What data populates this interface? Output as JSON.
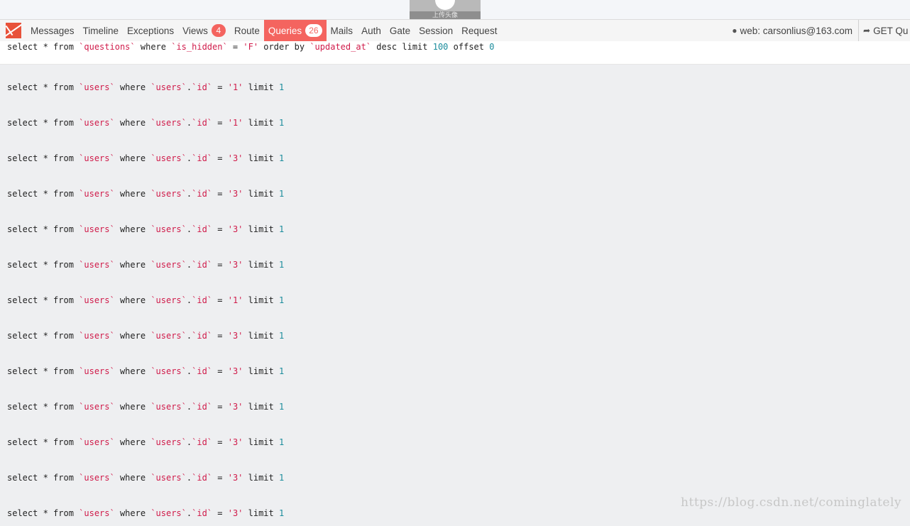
{
  "overlay": {
    "upload_label": "上传头像"
  },
  "debugbar": {
    "tabs": [
      {
        "label": "Messages",
        "badge": null
      },
      {
        "label": "Timeline",
        "badge": null
      },
      {
        "label": "Exceptions",
        "badge": null
      },
      {
        "label": "Views",
        "badge": "4"
      },
      {
        "label": "Route",
        "badge": null
      },
      {
        "label": "Queries",
        "badge": "26",
        "active": true
      },
      {
        "label": "Mails",
        "badge": null
      },
      {
        "label": "Auth",
        "badge": null
      },
      {
        "label": "Gate",
        "badge": null
      },
      {
        "label": "Session",
        "badge": null
      },
      {
        "label": "Request",
        "badge": null
      }
    ],
    "user": "web: carsonlius@163.com",
    "request": "GET Qu",
    "colors": {
      "accent": "#f4645f",
      "string": "#d01b4a",
      "number": "#1b8c9c"
    }
  },
  "queries": [
    [
      {
        "t": "select * from ",
        "c": "kw"
      },
      {
        "t": "`questions`",
        "c": "str"
      },
      {
        "t": " where ",
        "c": "kw"
      },
      {
        "t": "`is_hidden`",
        "c": "str"
      },
      {
        "t": " = ",
        "c": "kw"
      },
      {
        "t": "'F'",
        "c": "str"
      },
      {
        "t": " order by ",
        "c": "kw"
      },
      {
        "t": "`updated_at`",
        "c": "str"
      },
      {
        "t": " desc limit ",
        "c": "kw"
      },
      {
        "t": "100",
        "c": "num"
      },
      {
        "t": " offset ",
        "c": "kw"
      },
      {
        "t": "0",
        "c": "num"
      }
    ],
    [
      {
        "t": "select * from ",
        "c": "kw"
      },
      {
        "t": "`users`",
        "c": "str"
      },
      {
        "t": " where ",
        "c": "kw"
      },
      {
        "t": "`users`",
        "c": "str"
      },
      {
        "t": ".",
        "c": "kw"
      },
      {
        "t": "`id`",
        "c": "str"
      },
      {
        "t": " = ",
        "c": "kw"
      },
      {
        "t": "'1'",
        "c": "str"
      },
      {
        "t": " limit ",
        "c": "kw"
      },
      {
        "t": "1",
        "c": "num"
      }
    ],
    [
      {
        "t": "select * from ",
        "c": "kw"
      },
      {
        "t": "`users`",
        "c": "str"
      },
      {
        "t": " where ",
        "c": "kw"
      },
      {
        "t": "`users`",
        "c": "str"
      },
      {
        "t": ".",
        "c": "kw"
      },
      {
        "t": "`id`",
        "c": "str"
      },
      {
        "t": " = ",
        "c": "kw"
      },
      {
        "t": "'1'",
        "c": "str"
      },
      {
        "t": " limit ",
        "c": "kw"
      },
      {
        "t": "1",
        "c": "num"
      }
    ],
    [
      {
        "t": "select * from ",
        "c": "kw"
      },
      {
        "t": "`users`",
        "c": "str"
      },
      {
        "t": " where ",
        "c": "kw"
      },
      {
        "t": "`users`",
        "c": "str"
      },
      {
        "t": ".",
        "c": "kw"
      },
      {
        "t": "`id`",
        "c": "str"
      },
      {
        "t": " = ",
        "c": "kw"
      },
      {
        "t": "'3'",
        "c": "str"
      },
      {
        "t": " limit ",
        "c": "kw"
      },
      {
        "t": "1",
        "c": "num"
      }
    ],
    [
      {
        "t": "select * from ",
        "c": "kw"
      },
      {
        "t": "`users`",
        "c": "str"
      },
      {
        "t": " where ",
        "c": "kw"
      },
      {
        "t": "`users`",
        "c": "str"
      },
      {
        "t": ".",
        "c": "kw"
      },
      {
        "t": "`id`",
        "c": "str"
      },
      {
        "t": " = ",
        "c": "kw"
      },
      {
        "t": "'3'",
        "c": "str"
      },
      {
        "t": " limit ",
        "c": "kw"
      },
      {
        "t": "1",
        "c": "num"
      }
    ],
    [
      {
        "t": "select * from ",
        "c": "kw"
      },
      {
        "t": "`users`",
        "c": "str"
      },
      {
        "t": " where ",
        "c": "kw"
      },
      {
        "t": "`users`",
        "c": "str"
      },
      {
        "t": ".",
        "c": "kw"
      },
      {
        "t": "`id`",
        "c": "str"
      },
      {
        "t": " = ",
        "c": "kw"
      },
      {
        "t": "'3'",
        "c": "str"
      },
      {
        "t": " limit ",
        "c": "kw"
      },
      {
        "t": "1",
        "c": "num"
      }
    ],
    [
      {
        "t": "select * from ",
        "c": "kw"
      },
      {
        "t": "`users`",
        "c": "str"
      },
      {
        "t": " where ",
        "c": "kw"
      },
      {
        "t": "`users`",
        "c": "str"
      },
      {
        "t": ".",
        "c": "kw"
      },
      {
        "t": "`id`",
        "c": "str"
      },
      {
        "t": " = ",
        "c": "kw"
      },
      {
        "t": "'3'",
        "c": "str"
      },
      {
        "t": " limit ",
        "c": "kw"
      },
      {
        "t": "1",
        "c": "num"
      }
    ],
    [
      {
        "t": "select * from ",
        "c": "kw"
      },
      {
        "t": "`users`",
        "c": "str"
      },
      {
        "t": " where ",
        "c": "kw"
      },
      {
        "t": "`users`",
        "c": "str"
      },
      {
        "t": ".",
        "c": "kw"
      },
      {
        "t": "`id`",
        "c": "str"
      },
      {
        "t": " = ",
        "c": "kw"
      },
      {
        "t": "'1'",
        "c": "str"
      },
      {
        "t": " limit ",
        "c": "kw"
      },
      {
        "t": "1",
        "c": "num"
      }
    ],
    [
      {
        "t": "select * from ",
        "c": "kw"
      },
      {
        "t": "`users`",
        "c": "str"
      },
      {
        "t": " where ",
        "c": "kw"
      },
      {
        "t": "`users`",
        "c": "str"
      },
      {
        "t": ".",
        "c": "kw"
      },
      {
        "t": "`id`",
        "c": "str"
      },
      {
        "t": " = ",
        "c": "kw"
      },
      {
        "t": "'3'",
        "c": "str"
      },
      {
        "t": " limit ",
        "c": "kw"
      },
      {
        "t": "1",
        "c": "num"
      }
    ],
    [
      {
        "t": "select * from ",
        "c": "kw"
      },
      {
        "t": "`users`",
        "c": "str"
      },
      {
        "t": " where ",
        "c": "kw"
      },
      {
        "t": "`users`",
        "c": "str"
      },
      {
        "t": ".",
        "c": "kw"
      },
      {
        "t": "`id`",
        "c": "str"
      },
      {
        "t": " = ",
        "c": "kw"
      },
      {
        "t": "'3'",
        "c": "str"
      },
      {
        "t": " limit ",
        "c": "kw"
      },
      {
        "t": "1",
        "c": "num"
      }
    ],
    [
      {
        "t": "select * from ",
        "c": "kw"
      },
      {
        "t": "`users`",
        "c": "str"
      },
      {
        "t": " where ",
        "c": "kw"
      },
      {
        "t": "`users`",
        "c": "str"
      },
      {
        "t": ".",
        "c": "kw"
      },
      {
        "t": "`id`",
        "c": "str"
      },
      {
        "t": " = ",
        "c": "kw"
      },
      {
        "t": "'3'",
        "c": "str"
      },
      {
        "t": " limit ",
        "c": "kw"
      },
      {
        "t": "1",
        "c": "num"
      }
    ],
    [
      {
        "t": "select * from ",
        "c": "kw"
      },
      {
        "t": "`users`",
        "c": "str"
      },
      {
        "t": " where ",
        "c": "kw"
      },
      {
        "t": "`users`",
        "c": "str"
      },
      {
        "t": ".",
        "c": "kw"
      },
      {
        "t": "`id`",
        "c": "str"
      },
      {
        "t": " = ",
        "c": "kw"
      },
      {
        "t": "'3'",
        "c": "str"
      },
      {
        "t": " limit ",
        "c": "kw"
      },
      {
        "t": "1",
        "c": "num"
      }
    ],
    [
      {
        "t": "select * from ",
        "c": "kw"
      },
      {
        "t": "`users`",
        "c": "str"
      },
      {
        "t": " where ",
        "c": "kw"
      },
      {
        "t": "`users`",
        "c": "str"
      },
      {
        "t": ".",
        "c": "kw"
      },
      {
        "t": "`id`",
        "c": "str"
      },
      {
        "t": " = ",
        "c": "kw"
      },
      {
        "t": "'3'",
        "c": "str"
      },
      {
        "t": " limit ",
        "c": "kw"
      },
      {
        "t": "1",
        "c": "num"
      }
    ],
    [
      {
        "t": "select * from ",
        "c": "kw"
      },
      {
        "t": "`users`",
        "c": "str"
      },
      {
        "t": " where ",
        "c": "kw"
      },
      {
        "t": "`users`",
        "c": "str"
      },
      {
        "t": ".",
        "c": "kw"
      },
      {
        "t": "`id`",
        "c": "str"
      },
      {
        "t": " = ",
        "c": "kw"
      },
      {
        "t": "'3'",
        "c": "str"
      },
      {
        "t": " limit ",
        "c": "kw"
      },
      {
        "t": "1",
        "c": "num"
      }
    ]
  ],
  "watermark": "https://blog.csdn.net/cominglately"
}
